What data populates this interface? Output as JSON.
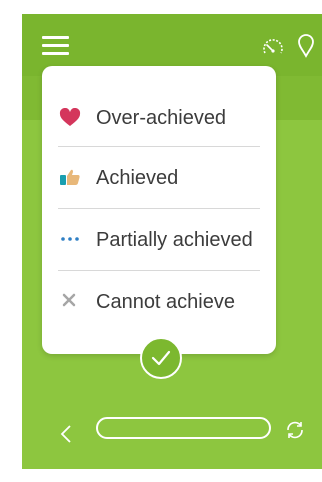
{
  "header": {
    "menu_icon": "hamburger-menu-icon",
    "action_icons": [
      "speedometer-icon",
      "location-pin-icon"
    ]
  },
  "achievement_options": [
    {
      "label": "Over-achieved",
      "icon": "heart-icon",
      "icon_color": "#d4365c"
    },
    {
      "label": "Achieved",
      "icon": "thumbs-up-icon",
      "icon_color": "#e8b87a"
    },
    {
      "label": "Partially achieved",
      "icon": "dots-icon",
      "icon_color": "#2f7fc4"
    },
    {
      "label": "Cannot achieve",
      "icon": "x-icon",
      "icon_color": "#a6a6a6"
    }
  ],
  "confirm_icon": "checkmark-icon",
  "footer": {
    "back_icon": "chevron-left-icon",
    "refresh_icon": "refresh-icon"
  },
  "colors": {
    "background": "#8dc63f",
    "header": "#7ab52e",
    "accent": "#7cb82f",
    "card": "#ffffff"
  }
}
